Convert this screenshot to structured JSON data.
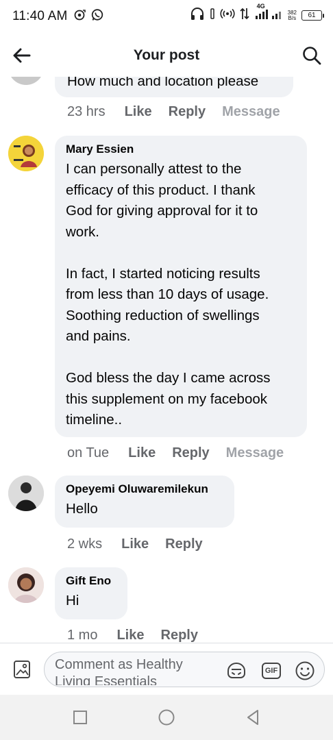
{
  "status_bar": {
    "time": "11:40 AM",
    "network": "4G",
    "speed_value": "382",
    "speed_unit": "B/s",
    "battery": "61"
  },
  "header": {
    "title": "Your post"
  },
  "comments": [
    {
      "text": "How much and location please",
      "time": "23 hrs",
      "like": "Like",
      "reply": "Reply",
      "message": "Message"
    },
    {
      "name": "Mary Essien",
      "text": "I can personally attest to the\nefficacy of this product. I thank\nGod for giving approval for it to\nwork.\n\nIn fact, I started noticing results\nfrom less than 10 days of usage.\nSoothing reduction of swellings\nand pains.\n\nGod bless the day I came across\nthis supplement on my facebook\ntimeline..",
      "time": "on Tue",
      "like": "Like",
      "reply": "Reply",
      "message": "Message"
    },
    {
      "name": "Opeyemi Oluwaremilekun",
      "text": "Hello",
      "time": "2 wks",
      "like": "Like",
      "reply": "Reply"
    },
    {
      "name": "Gift Eno",
      "text": "Hi",
      "time": "1 mo",
      "like": "Like",
      "reply": "Reply"
    }
  ],
  "composer": {
    "placeholder": "Comment as Healthy Living Essentials",
    "icons": [
      "photo-icon",
      "avatar-sticker-icon",
      "gif-icon",
      "emoji-icon"
    ],
    "gif_label": "GIF"
  },
  "nav": {
    "icons": [
      "recents-square-icon",
      "home-circle-icon",
      "back-triangle-icon"
    ]
  },
  "colors": {
    "bubble": "#f0f2f5",
    "meta_text": "#65676b",
    "faint_action": "#a0a3a8"
  }
}
